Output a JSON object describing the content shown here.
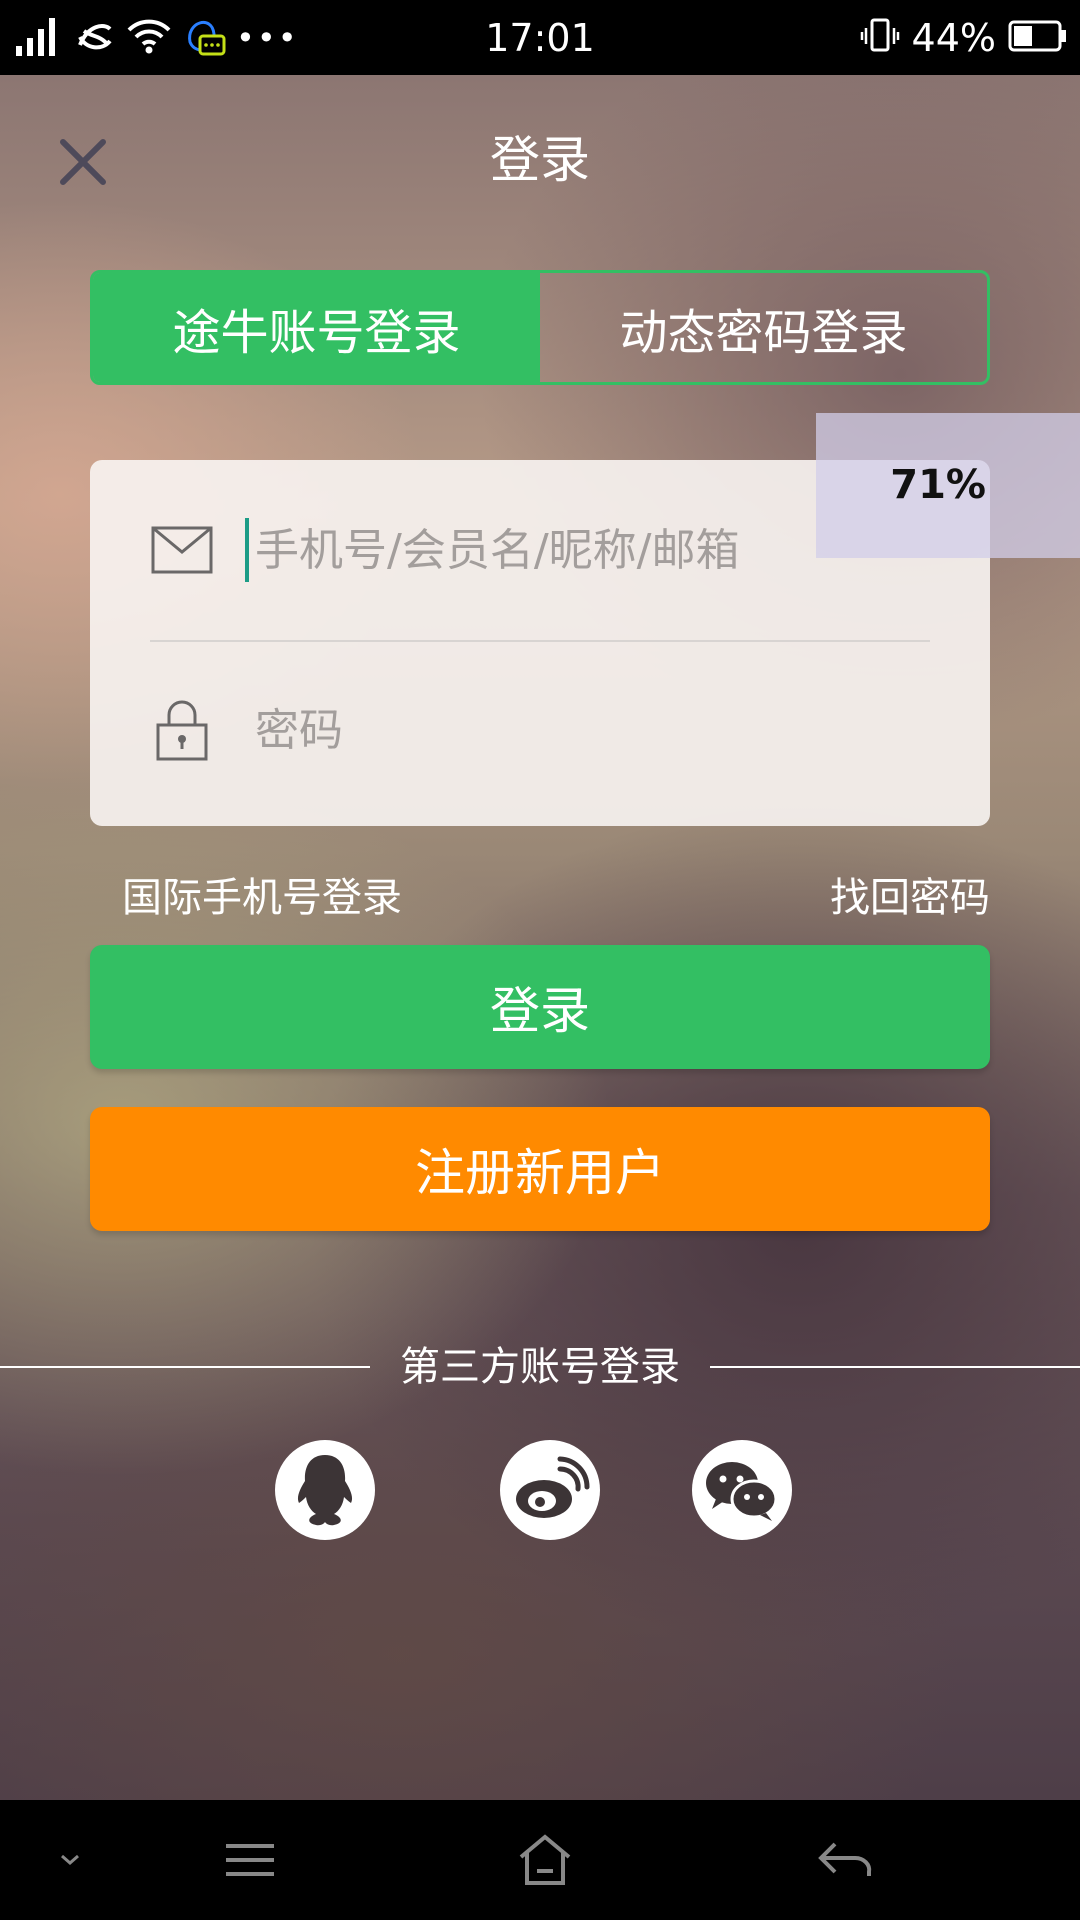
{
  "status_bar": {
    "time": "17:01",
    "battery_percent": "44%",
    "battery_level": 0.44,
    "overflow": "•••",
    "icons": [
      "signal-icon",
      "carrier-icon",
      "wifi-icon",
      "notification-icon",
      "vibrate-icon",
      "battery-icon"
    ]
  },
  "header": {
    "title": "登录",
    "close_icon": "close-icon"
  },
  "tabs": [
    {
      "label": "途牛账号登录",
      "active": true
    },
    {
      "label": "动态密码登录",
      "active": false
    }
  ],
  "form": {
    "username_placeholder": "手机号/会员名/昵称/邮箱",
    "password_placeholder": "密码",
    "username_icon": "mail-icon",
    "password_icon": "lock-icon"
  },
  "overlay": {
    "percent": "71%"
  },
  "links": {
    "intl_login": "国际手机号登录",
    "forgot_password": "找回密码"
  },
  "buttons": {
    "login": "登录",
    "register": "注册新用户"
  },
  "third_party": {
    "title": "第三方账号登录",
    "providers": [
      "qq-icon",
      "weibo-icon",
      "wechat-icon"
    ]
  },
  "nav_bar": {
    "icons": [
      "collapse-icon",
      "menu-icon",
      "home-icon",
      "back-icon"
    ]
  },
  "colors": {
    "green": "#33bf63",
    "orange": "#ff8a00"
  }
}
